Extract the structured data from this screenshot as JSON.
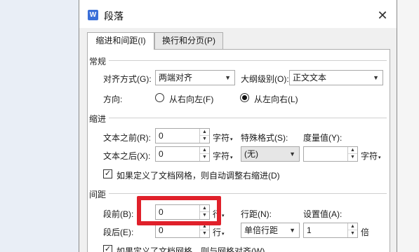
{
  "dialog": {
    "title": "段落",
    "app_icon_letter": "W",
    "close_glyph": "✕"
  },
  "tabs": [
    {
      "label": "缩进和间距(I)",
      "active": true
    },
    {
      "label": "换行和分页(P)",
      "active": false
    }
  ],
  "general": {
    "section_title": "常规",
    "alignment_label": "对齐方式(G):",
    "alignment_value": "两端对齐",
    "outline_label": "大纲级别(O):",
    "outline_value": "正文文本",
    "direction_label": "方向:",
    "direction_options": [
      {
        "label": "从右向左(F)",
        "selected": false
      },
      {
        "label": "从左向右(L)",
        "selected": true
      }
    ]
  },
  "indent": {
    "section_title": "缩进",
    "before_text_label": "文本之前(R):",
    "before_text_value": "0",
    "before_text_unit": "字符",
    "after_text_label": "文本之后(X):",
    "after_text_value": "0",
    "after_text_unit": "字符",
    "special_label": "特殊格式(S):",
    "special_value": "(无)",
    "measure_label": "度量值(Y):",
    "measure_value": "",
    "measure_unit": "字符",
    "grid_checkbox_label": "如果定义了文档网格，则自动调整右缩进(D)",
    "grid_checked": true
  },
  "spacing": {
    "section_title": "间距",
    "before_label": "段前(B):",
    "before_value": "0",
    "before_unit": "行",
    "after_label": "段后(E):",
    "after_value": "0",
    "after_unit": "行",
    "line_spacing_label": "行距(N):",
    "line_spacing_value": "单倍行距",
    "setting_label": "设置值(A):",
    "setting_value": "1",
    "setting_unit": "倍",
    "grid_checkbox_label": "如果定义了文档网格，则与网格对齐(W)",
    "grid_checked": true
  },
  "glyphs": {
    "dropdown_arrow": "▼",
    "spin_up": "▲",
    "spin_down": "▼",
    "unit_arrow": "▾",
    "check": "✓"
  },
  "colors": {
    "highlight": "#e0202a",
    "app_icon": "#3b6fd8"
  },
  "icons": [
    "app-icon",
    "close-icon",
    "dropdown-arrow-icon",
    "spin-up-icon",
    "spin-down-icon"
  ]
}
